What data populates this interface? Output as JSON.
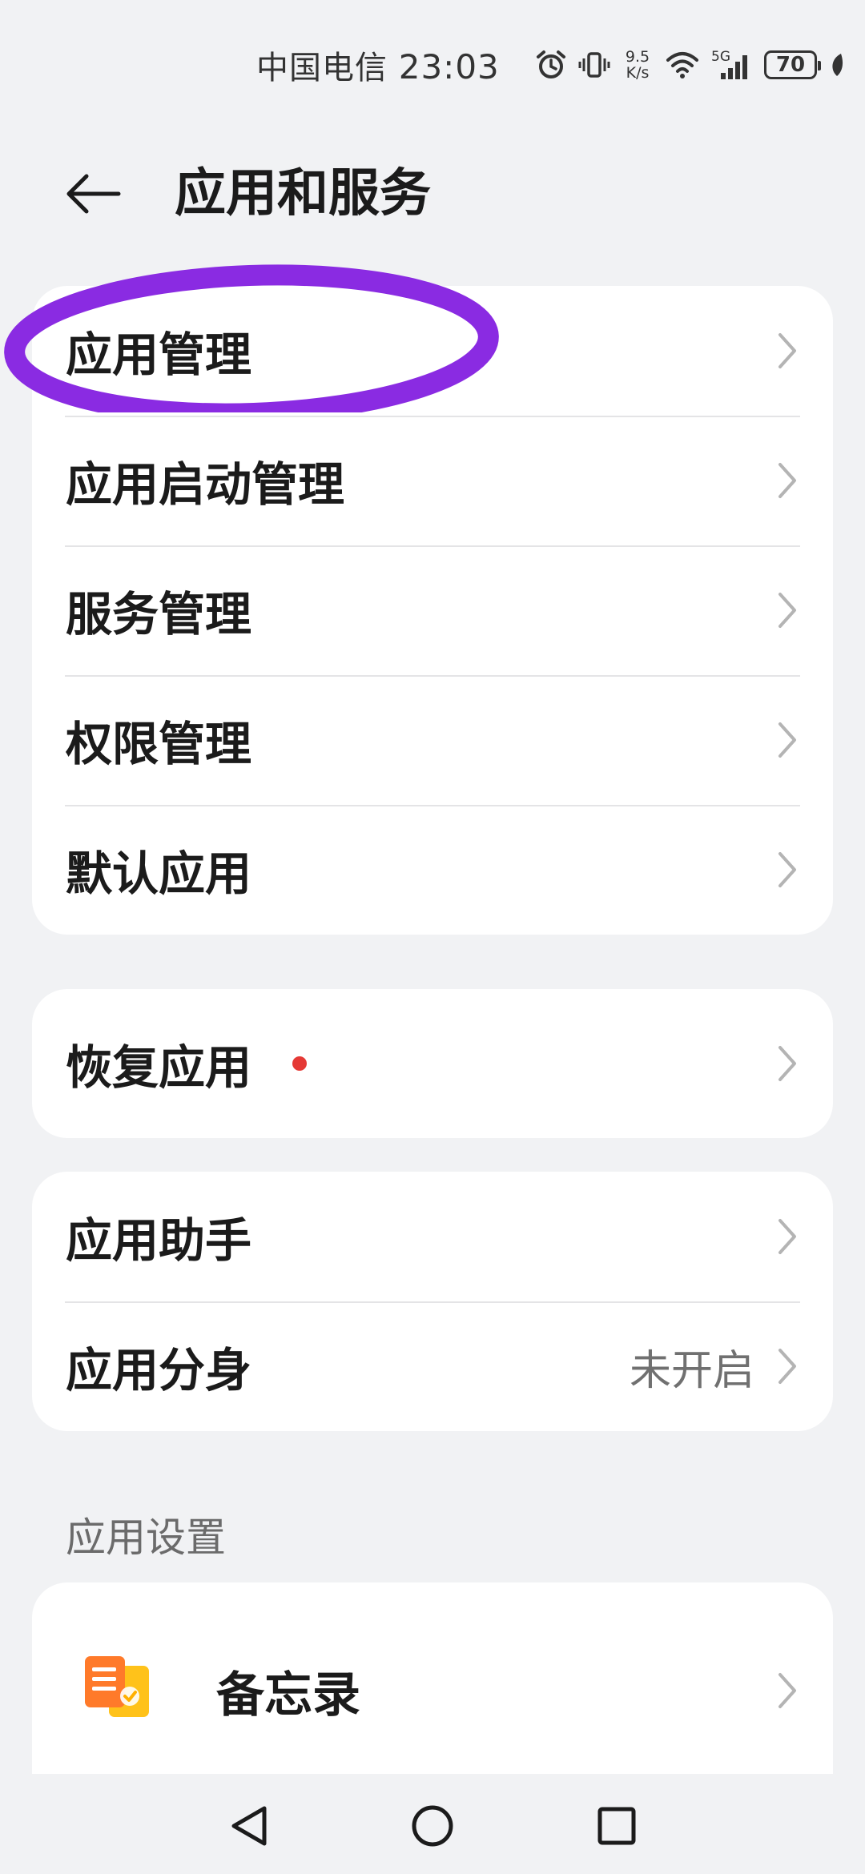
{
  "status_bar": {
    "carrier": "中国电信",
    "time": "23:03",
    "net_speed_value": "9.5",
    "net_speed_unit": "K/s",
    "network_type": "5G",
    "battery_level": "70"
  },
  "header": {
    "title": "应用和服务"
  },
  "card1": {
    "items": [
      {
        "label": "应用管理"
      },
      {
        "label": "应用启动管理"
      },
      {
        "label": "服务管理"
      },
      {
        "label": "权限管理"
      },
      {
        "label": "默认应用"
      }
    ]
  },
  "card2": {
    "items": [
      {
        "label": "恢复应用"
      }
    ]
  },
  "card3": {
    "items": [
      {
        "label": "应用助手"
      },
      {
        "label": "应用分身",
        "value": "未开启"
      }
    ]
  },
  "app_settings": {
    "section_label": "应用设置",
    "items": [
      {
        "label": "备忘录",
        "icon": "memo-app-icon"
      }
    ]
  },
  "colors": {
    "annotation": "#8a2be2",
    "red_dot": "#e53935",
    "background": "#f1f2f4"
  }
}
